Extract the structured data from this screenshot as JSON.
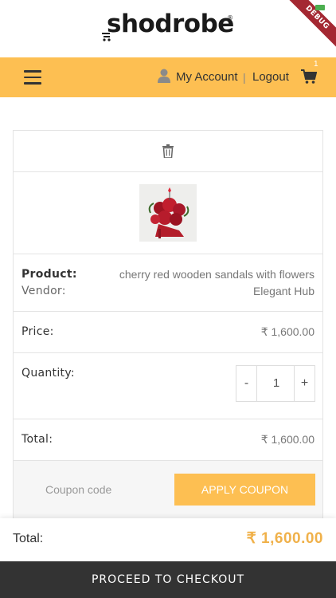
{
  "app": {
    "brand": "shodrobe",
    "brand_mark": "®",
    "debug_banner": "DEBUG"
  },
  "nav": {
    "menu_icon": "hamburger-icon",
    "my_account": "My Account",
    "separator": "|",
    "logout": "Logout",
    "cart_icon": "cart-icon",
    "cart_count": "1"
  },
  "cart": {
    "delete_icon": "trash-icon",
    "product_label": "Product:",
    "product_name": "cherry red wooden sandals with flowers",
    "vendor_label": "Vendor:",
    "vendor_name": "Elegant Hub",
    "price_label": "Price:",
    "price_value": "₹ 1,600.00",
    "quantity_label": "Quantity:",
    "quantity_minus": "-",
    "quantity_value": "1",
    "quantity_plus": "+",
    "total_label": "Total:",
    "total_value": "₹ 1,600.00",
    "coupon_placeholder": "Coupon code",
    "apply_coupon": "APPLY COUPON"
  },
  "footer": {
    "total_label": "Total:",
    "total_value": "₹ 1,600.00",
    "checkout": "PROCEED TO CHECKOUT"
  },
  "colors": {
    "accent": "#fdbf52",
    "total_value": "#f0b14a",
    "checkout_bg": "#333333",
    "debug": "#a42832"
  }
}
